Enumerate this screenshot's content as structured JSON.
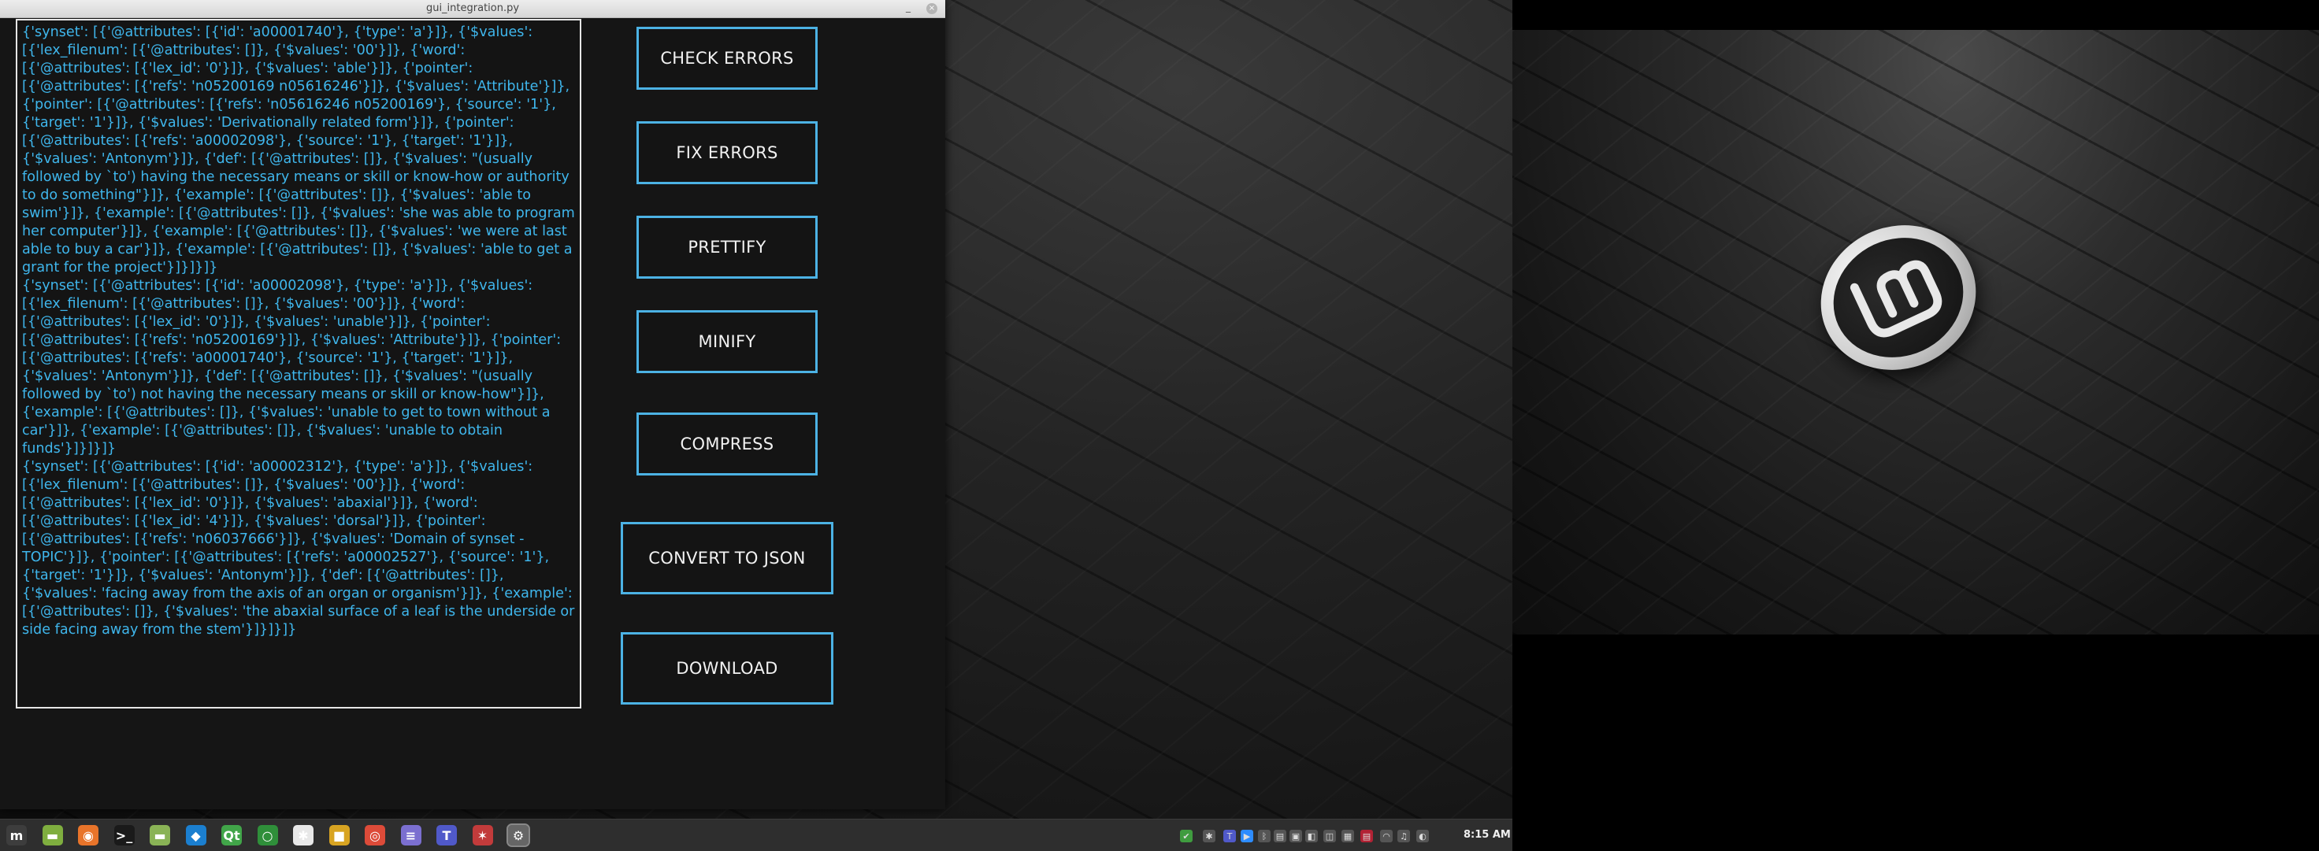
{
  "window": {
    "title": "gui_integration.py",
    "minimize_glyph": "_",
    "close_glyph": "×"
  },
  "output_records": [
    "{'synset': [{'@attributes': [{'id': 'a00001740'}, {'type': 'a'}]}, {'$values': [{'lex_filenum': [{'@attributes': []}, {'$values': '00'}]}, {'word': [{'@attributes': [{'lex_id': '0'}]}, {'$values': 'able'}]}, {'pointer': [{'@attributes': [{'refs': 'n05200169 n05616246'}]}, {'$values': 'Attribute'}]}, {'pointer': [{'@attributes': [{'refs': 'n05616246 n05200169'}, {'source': '1'}, {'target': '1'}]}, {'$values': 'Derivationally related form'}]}, {'pointer': [{'@attributes': [{'refs': 'a00002098'}, {'source': '1'}, {'target': '1'}]}, {'$values': 'Antonym'}]}, {'def': [{'@attributes': []}, {'$values': \"(usually followed by `to') having the necessary means or skill or know-how or authority to do something\"}]}, {'example': [{'@attributes': []}, {'$values': 'able to swim'}]}, {'example': [{'@attributes': []}, {'$values': 'she was able to program her computer'}]}, {'example': [{'@attributes': []}, {'$values': 'we were at last able to buy a car'}]}, {'example': [{'@attributes': []}, {'$values': 'able to get a grant for the project'}]}]}]}",
    "{'synset': [{'@attributes': [{'id': 'a00002098'}, {'type': 'a'}]}, {'$values': [{'lex_filenum': [{'@attributes': []}, {'$values': '00'}]}, {'word': [{'@attributes': [{'lex_id': '0'}]}, {'$values': 'unable'}]}, {'pointer': [{'@attributes': [{'refs': 'n05200169'}]}, {'$values': 'Attribute'}]}, {'pointer': [{'@attributes': [{'refs': 'a00001740'}, {'source': '1'}, {'target': '1'}]}, {'$values': 'Antonym'}]}, {'def': [{'@attributes': []}, {'$values': \"(usually followed by `to') not having the necessary means or skill or know-how\"}]}, {'example': [{'@attributes': []}, {'$values': 'unable to get to town without a car'}]}, {'example': [{'@attributes': []}, {'$values': 'unable to obtain funds'}]}]}]}",
    "{'synset': [{'@attributes': [{'id': 'a00002312'}, {'type': 'a'}]}, {'$values': [{'lex_filenum': [{'@attributes': []}, {'$values': '00'}]}, {'word': [{'@attributes': [{'lex_id': '0'}]}, {'$values': 'abaxial'}]}, {'word': [{'@attributes': [{'lex_id': '4'}]}, {'$values': 'dorsal'}]}, {'pointer': [{'@attributes': [{'refs': 'n06037666'}]}, {'$values': 'Domain of synset - TOPIC'}]}, {'pointer': [{'@attributes': [{'refs': 'a00002527'}, {'source': '1'}, {'target': '1'}]}, {'$values': 'Antonym'}]}, {'def': [{'@attributes': []}, {'$values': 'facing away from the axis of an organ or organism'}]}, {'example': [{'@attributes': []}, {'$values': 'the abaxial surface of a leaf is the underside or side facing away from the stem'}]}]}]}"
  ],
  "buttons": {
    "check_errors": "CHECK ERRORS",
    "fix_errors": "FIX ERRORS",
    "prettify": "PRETTIFY",
    "minify": "MINIFY",
    "compress": "COMPRESS",
    "convert_to_json": "CONVERT TO JSON",
    "download": "DOWNLOAD"
  },
  "taskbar": {
    "apps": [
      {
        "icon": "mint-menu-icon",
        "glyph": "m",
        "color": "#3d3d3d"
      },
      {
        "icon": "files-icon",
        "glyph": "▬",
        "color": "#7fae3f"
      },
      {
        "icon": "firefox-icon",
        "glyph": "◉",
        "color": "#e8742a"
      },
      {
        "icon": "terminal-icon",
        "glyph": ">_",
        "color": "#1a1a1a"
      },
      {
        "icon": "folder-icon",
        "glyph": "▬",
        "color": "#8ab356"
      },
      {
        "icon": "vscode-icon",
        "glyph": "◆",
        "color": "#1b7fcf"
      },
      {
        "icon": "qt-creator-icon",
        "glyph": "Qt",
        "color": "#41a549"
      },
      {
        "icon": "circle-app-icon",
        "glyph": "○",
        "color": "#2f8f3a"
      },
      {
        "icon": "slack-icon",
        "glyph": "✱",
        "color": "#e8e8e8"
      },
      {
        "icon": "colorful-app-icon",
        "glyph": "■",
        "color": "#d8a422"
      },
      {
        "icon": "chrome-icon",
        "glyph": "◎",
        "color": "#dd4b39"
      },
      {
        "icon": "notes-icon",
        "glyph": "≡",
        "color": "#7b6fd0"
      },
      {
        "icon": "teams-icon",
        "glyph": "T",
        "color": "#5059c9"
      },
      {
        "icon": "network-app-icon",
        "glyph": "✶",
        "color": "#c23b3b"
      },
      {
        "icon": "settings-app-icon",
        "glyph": "⚙",
        "color": "#666666"
      }
    ],
    "tray": [
      {
        "icon": "update-shield-icon",
        "glyph": "✔",
        "color": "#3f9c3f"
      },
      {
        "icon": "slack-tray-icon",
        "glyph": "✱",
        "color": "#555555"
      },
      {
        "icon": "teams-tray-icon",
        "glyph": "T",
        "color": "#5059c9"
      },
      {
        "icon": "zoom-icon",
        "glyph": "▶",
        "color": "#2d8cff"
      },
      {
        "icon": "bluetooth-icon",
        "glyph": "ᛒ",
        "color": "#555555"
      },
      {
        "icon": "clipboard-icon",
        "glyph": "▤",
        "color": "#555555"
      },
      {
        "icon": "display-icon",
        "glyph": "▣",
        "color": "#555555"
      },
      {
        "icon": "nvidia-icon",
        "glyph": "◧",
        "color": "#555555"
      },
      {
        "icon": "screenshot-icon",
        "glyph": "◫",
        "color": "#555555"
      },
      {
        "icon": "keyboard-layout-icon",
        "glyph": "▦",
        "color": "#555555"
      },
      {
        "icon": "us-flag-icon",
        "glyph": "▤",
        "color": "#b22234"
      },
      {
        "icon": "wifi-icon",
        "glyph": "◠",
        "color": "#555555"
      },
      {
        "icon": "volume-icon",
        "glyph": "♫",
        "color": "#555555"
      },
      {
        "icon": "user-session-icon",
        "glyph": "◐",
        "color": "#555555"
      }
    ],
    "clock": "8:15 AM"
  }
}
